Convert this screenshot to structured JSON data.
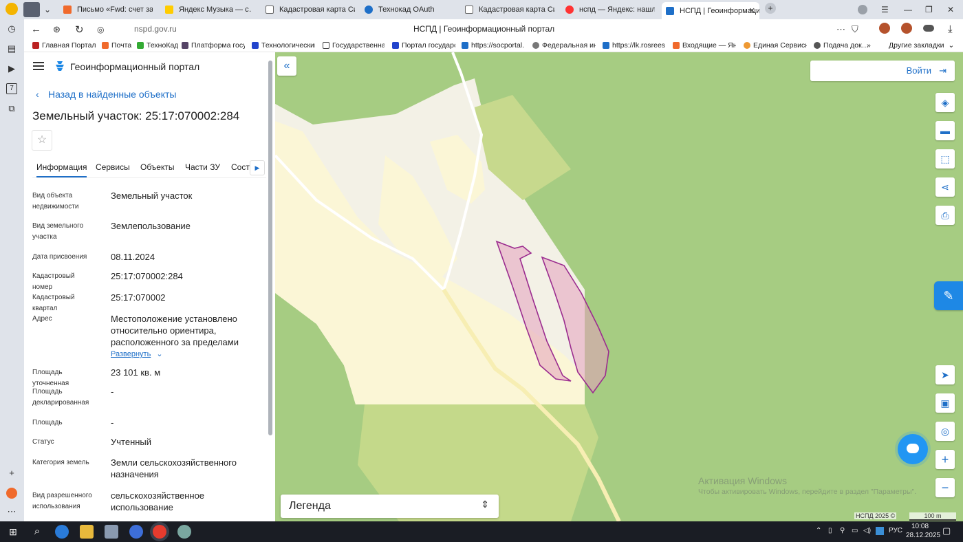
{
  "browser": {
    "tabs": [
      {
        "label": "Письмо «Fwd: счет за де…",
        "color": "#f06a2c"
      },
      {
        "label": "Яндекс Музыка — с…",
        "color": "#ffcc00"
      },
      {
        "label": "Кадастровая карта Сиби…",
        "color": "#666666"
      },
      {
        "label": "Технокад OAuth",
        "color": "#1e6fc8"
      },
      {
        "label": "Кадастровая карта Сиби…",
        "color": "#666666"
      },
      {
        "label": "нспд — Яндекс: нашлось…",
        "color": "#f33"
      },
      {
        "label": "НСПД | Геоинформаци…",
        "color": "#1e6fc8"
      }
    ],
    "url": "nspd.gov.ru",
    "page_title": "НСПД | Геоинформационный портал",
    "bookmarks": [
      "Главная Портал З…",
      "Почта",
      "ТехноКад",
      "Платформа госуд…",
      "Технологический…",
      "Государственная…",
      "Портал государст…",
      "https://socportal.…",
      "Федеральная инф…",
      "https://lk.rosrees…",
      "Входящие — Янде…",
      "Единая Сервисна…",
      "Подача док…"
    ],
    "other_bookmarks": "Другие закладки",
    "sidebar_badge": "7"
  },
  "panel": {
    "portal_title": "Геоинформационный портал",
    "back_link": "Назад в найденные объекты",
    "object_title": "Земельный участок: 25:17:070002:284",
    "tabs": [
      "Информация",
      "Сервисы",
      "Объекты",
      "Части ЗУ",
      "Соста…"
    ],
    "fields": [
      {
        "label": "Вид объекта недвижимости",
        "value": "Земельный участок"
      },
      {
        "label": "Вид земельного участка",
        "value": "Землепользование"
      },
      {
        "label": "Дата присвоения",
        "value": "08.11.2024"
      },
      {
        "label": "Кадастровый номер",
        "value": "25:17:070002:284"
      },
      {
        "label": "Кадастровый квартал",
        "value": "25:17:070002"
      },
      {
        "label": "Адрес",
        "value": "Местоположение установлено относительно ориентира, расположенного за пределами"
      },
      {
        "label": "Площадь уточненная",
        "value": "23 101 кв. м"
      },
      {
        "label": "Площадь декларированная",
        "value": "-"
      },
      {
        "label": "Площадь",
        "value": "-"
      },
      {
        "label": "Статус",
        "value": "Учтенный"
      },
      {
        "label": "Категория земель",
        "value": "Земли сельскохозяйственного назначения"
      },
      {
        "label": "Вид разрешенного использования",
        "value": "сельскохозяйственное использование"
      }
    ],
    "expand_link": "Развернуть"
  },
  "map": {
    "login_label": "Войти",
    "legend_label": "Легенда",
    "watermark_line1": "Активация Windows",
    "watermark_line2": "Чтобы активировать Windows, перейдите в раздел \"Параметры\".",
    "copyright": "НСПД 2025 ©",
    "scale": "100 m"
  },
  "taskbar": {
    "lang": "РУС",
    "time": "10:08",
    "date": "28.12.2025"
  }
}
